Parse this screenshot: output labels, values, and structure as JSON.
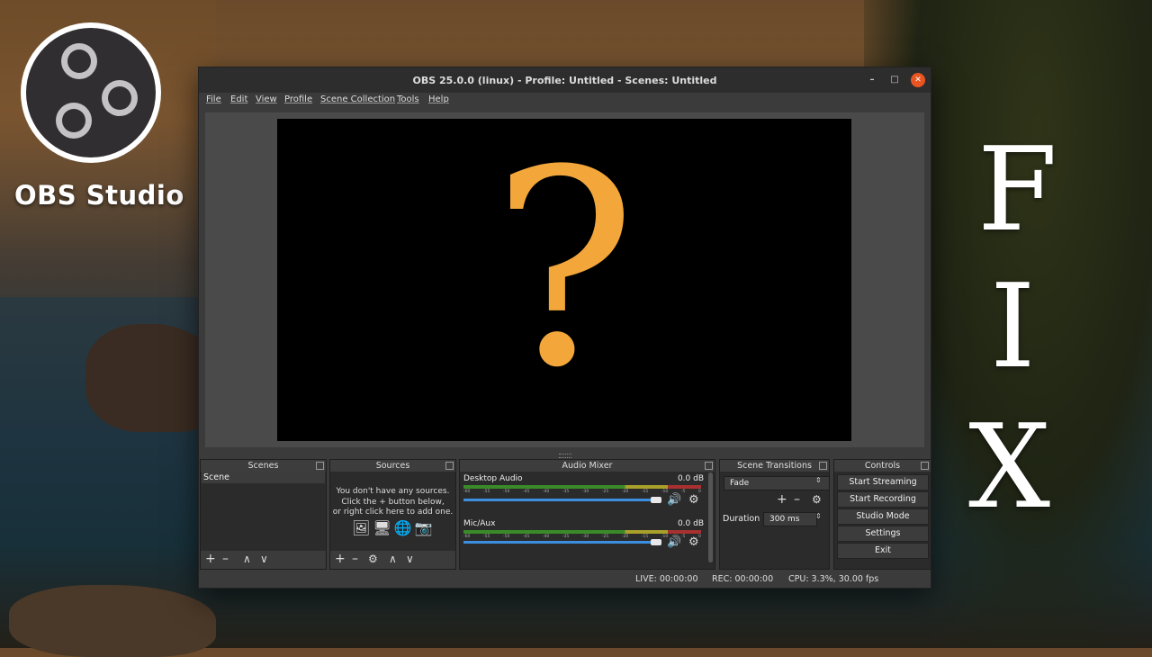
{
  "brand": {
    "label": "OBS Studio",
    "logo_icon": "obs-logo-icon"
  },
  "overlay": {
    "letters": [
      "F",
      "I",
      "X"
    ]
  },
  "window": {
    "title": "OBS 25.0.0 (linux) - Profile: Untitled - Scenes: Untitled",
    "controls": {
      "minimize": "–",
      "maximize": "□",
      "close": "✕"
    },
    "accent_close": "#e95420"
  },
  "menu": [
    "File",
    "Edit",
    "View",
    "Profile",
    "Scene Collection",
    "Tools",
    "Help"
  ],
  "preview": {
    "placeholder_glyph": "?",
    "glyph_color": "#f3a73b"
  },
  "docks": {
    "scenes": {
      "title": "Scenes",
      "items": [
        "Scene"
      ],
      "tools": [
        "+",
        "–",
        "∧",
        "∨"
      ]
    },
    "sources": {
      "title": "Sources",
      "hint_lines": [
        "You don't have any sources.",
        "Click the + button below,",
        "or right click here to add one."
      ],
      "tools": [
        "+",
        "–",
        "⚙",
        "∧",
        "∨"
      ]
    },
    "mixer": {
      "title": "Audio Mixer",
      "tick_labels": [
        "-60",
        "-55",
        "-50",
        "-45",
        "-40",
        "-35",
        "-30",
        "-25",
        "-20",
        "-15",
        "-10",
        "-5",
        "0"
      ],
      "channels": [
        {
          "name": "Desktop Audio",
          "db": "0.0 dB",
          "volume": 1.0
        },
        {
          "name": "Mic/Aux",
          "db": "0.0 dB",
          "volume": 1.0
        }
      ]
    },
    "transitions": {
      "title": "Scene Transitions",
      "selected": "Fade",
      "duration_label": "Duration",
      "duration_value": "300 ms",
      "tools": [
        "+",
        "–",
        "⚙"
      ]
    },
    "controls": {
      "title": "Controls",
      "buttons": [
        "Start Streaming",
        "Start Recording",
        "Studio Mode",
        "Settings",
        "Exit"
      ]
    }
  },
  "status": {
    "live": "LIVE: 00:00:00",
    "rec": "REC: 00:00:00",
    "cpu": "CPU: 3.3%, 30.00 fps"
  }
}
